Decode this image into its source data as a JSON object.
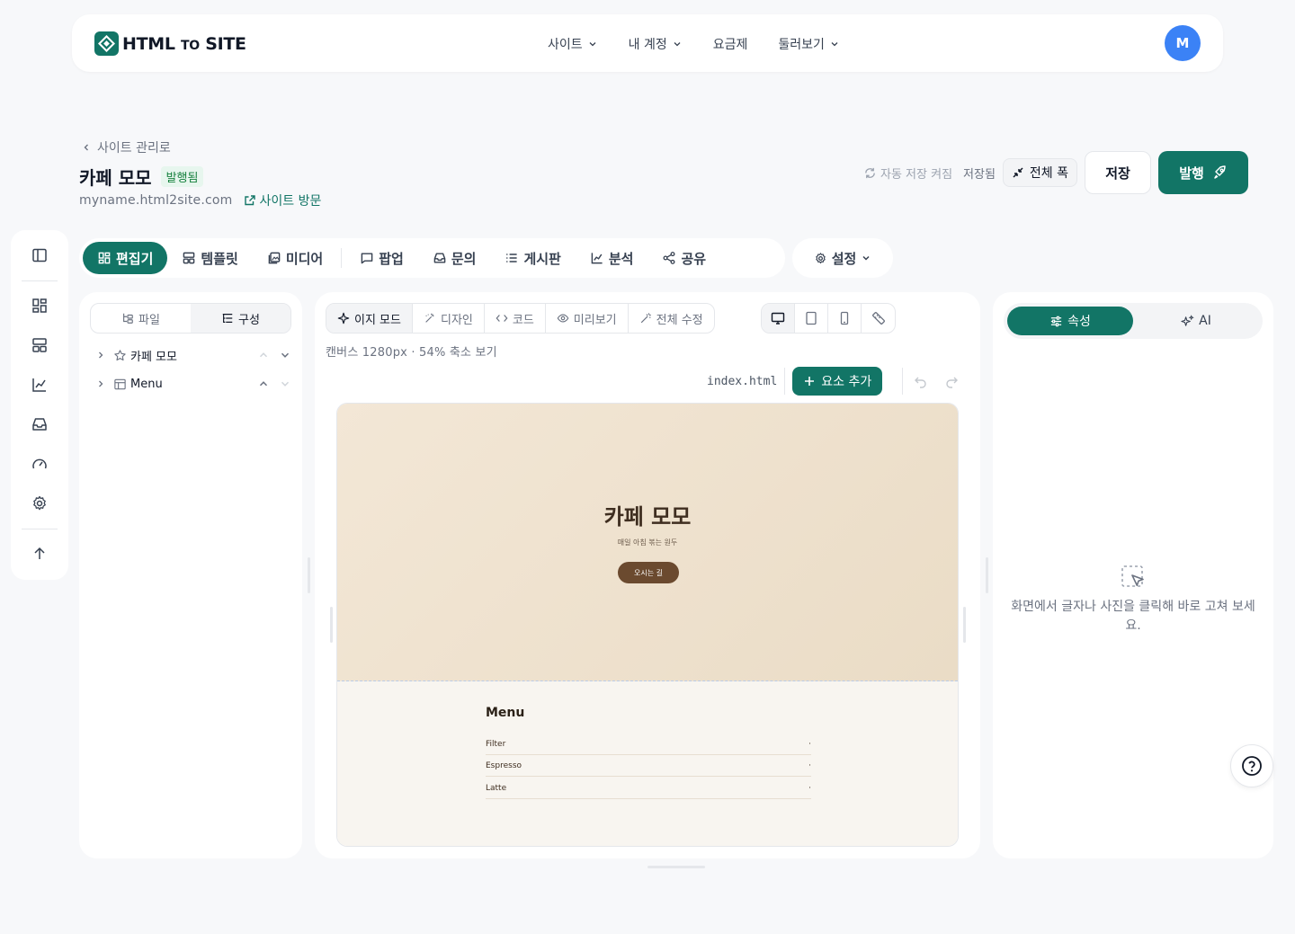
{
  "brand": {
    "name_a": "HTML",
    "name_b": "TO",
    "name_c": "SITE",
    "accent": "#127566"
  },
  "nav": {
    "items": [
      {
        "label": "사이트"
      },
      {
        "label": "내 계정"
      },
      {
        "label": "요금제"
      },
      {
        "label": "둘러보기"
      }
    ],
    "avatar_initial": "M"
  },
  "header": {
    "back_label": "사이트 관리로",
    "site_title": "카페 모모",
    "status_badge": "발행됨",
    "domain": "myname.html2site.com",
    "visit_label": "사이트 방문",
    "autosave_label": "자동 저장 켜짐",
    "saved_label": "저장됨",
    "fullwidth_label": "전체 폭",
    "save_label": "저장",
    "publish_label": "발행"
  },
  "tabs": {
    "items": [
      {
        "label": "편집기"
      },
      {
        "label": "템플릿"
      },
      {
        "label": "미디어"
      },
      {
        "label": "팝업"
      },
      {
        "label": "문의"
      },
      {
        "label": "게시판"
      },
      {
        "label": "분석"
      },
      {
        "label": "공유"
      }
    ],
    "settings_label": "설정"
  },
  "left_panel": {
    "seg": [
      {
        "label": "파일"
      },
      {
        "label": "구성"
      }
    ],
    "tree": [
      {
        "label": "카페 모모"
      },
      {
        "label": "Menu"
      }
    ]
  },
  "editor": {
    "modes": [
      {
        "label": "이지 모드"
      },
      {
        "label": "디자인"
      },
      {
        "label": "코드"
      },
      {
        "label": "미리보기"
      },
      {
        "label": "전체 수정"
      }
    ],
    "canvas_info": "캔버스 1280px · 54% 축소 보기",
    "file_name": "index.html",
    "add_element_label": "요소 추가"
  },
  "preview": {
    "hero_title": "카페 모모",
    "hero_sub": "매일 아침 볶는 원두",
    "hero_cta": "오시는 길",
    "menu_title": "Menu",
    "menu_items": [
      {
        "name": "Filter",
        "price": "·"
      },
      {
        "name": "Espresso",
        "price": "·"
      },
      {
        "name": "Latte",
        "price": "·"
      }
    ]
  },
  "right_panel": {
    "seg": [
      {
        "label": "속성"
      },
      {
        "label": "AI"
      }
    ],
    "empty_message": "화면에서 글자나 사진을 클릭해 바로 고쳐 보세요."
  }
}
